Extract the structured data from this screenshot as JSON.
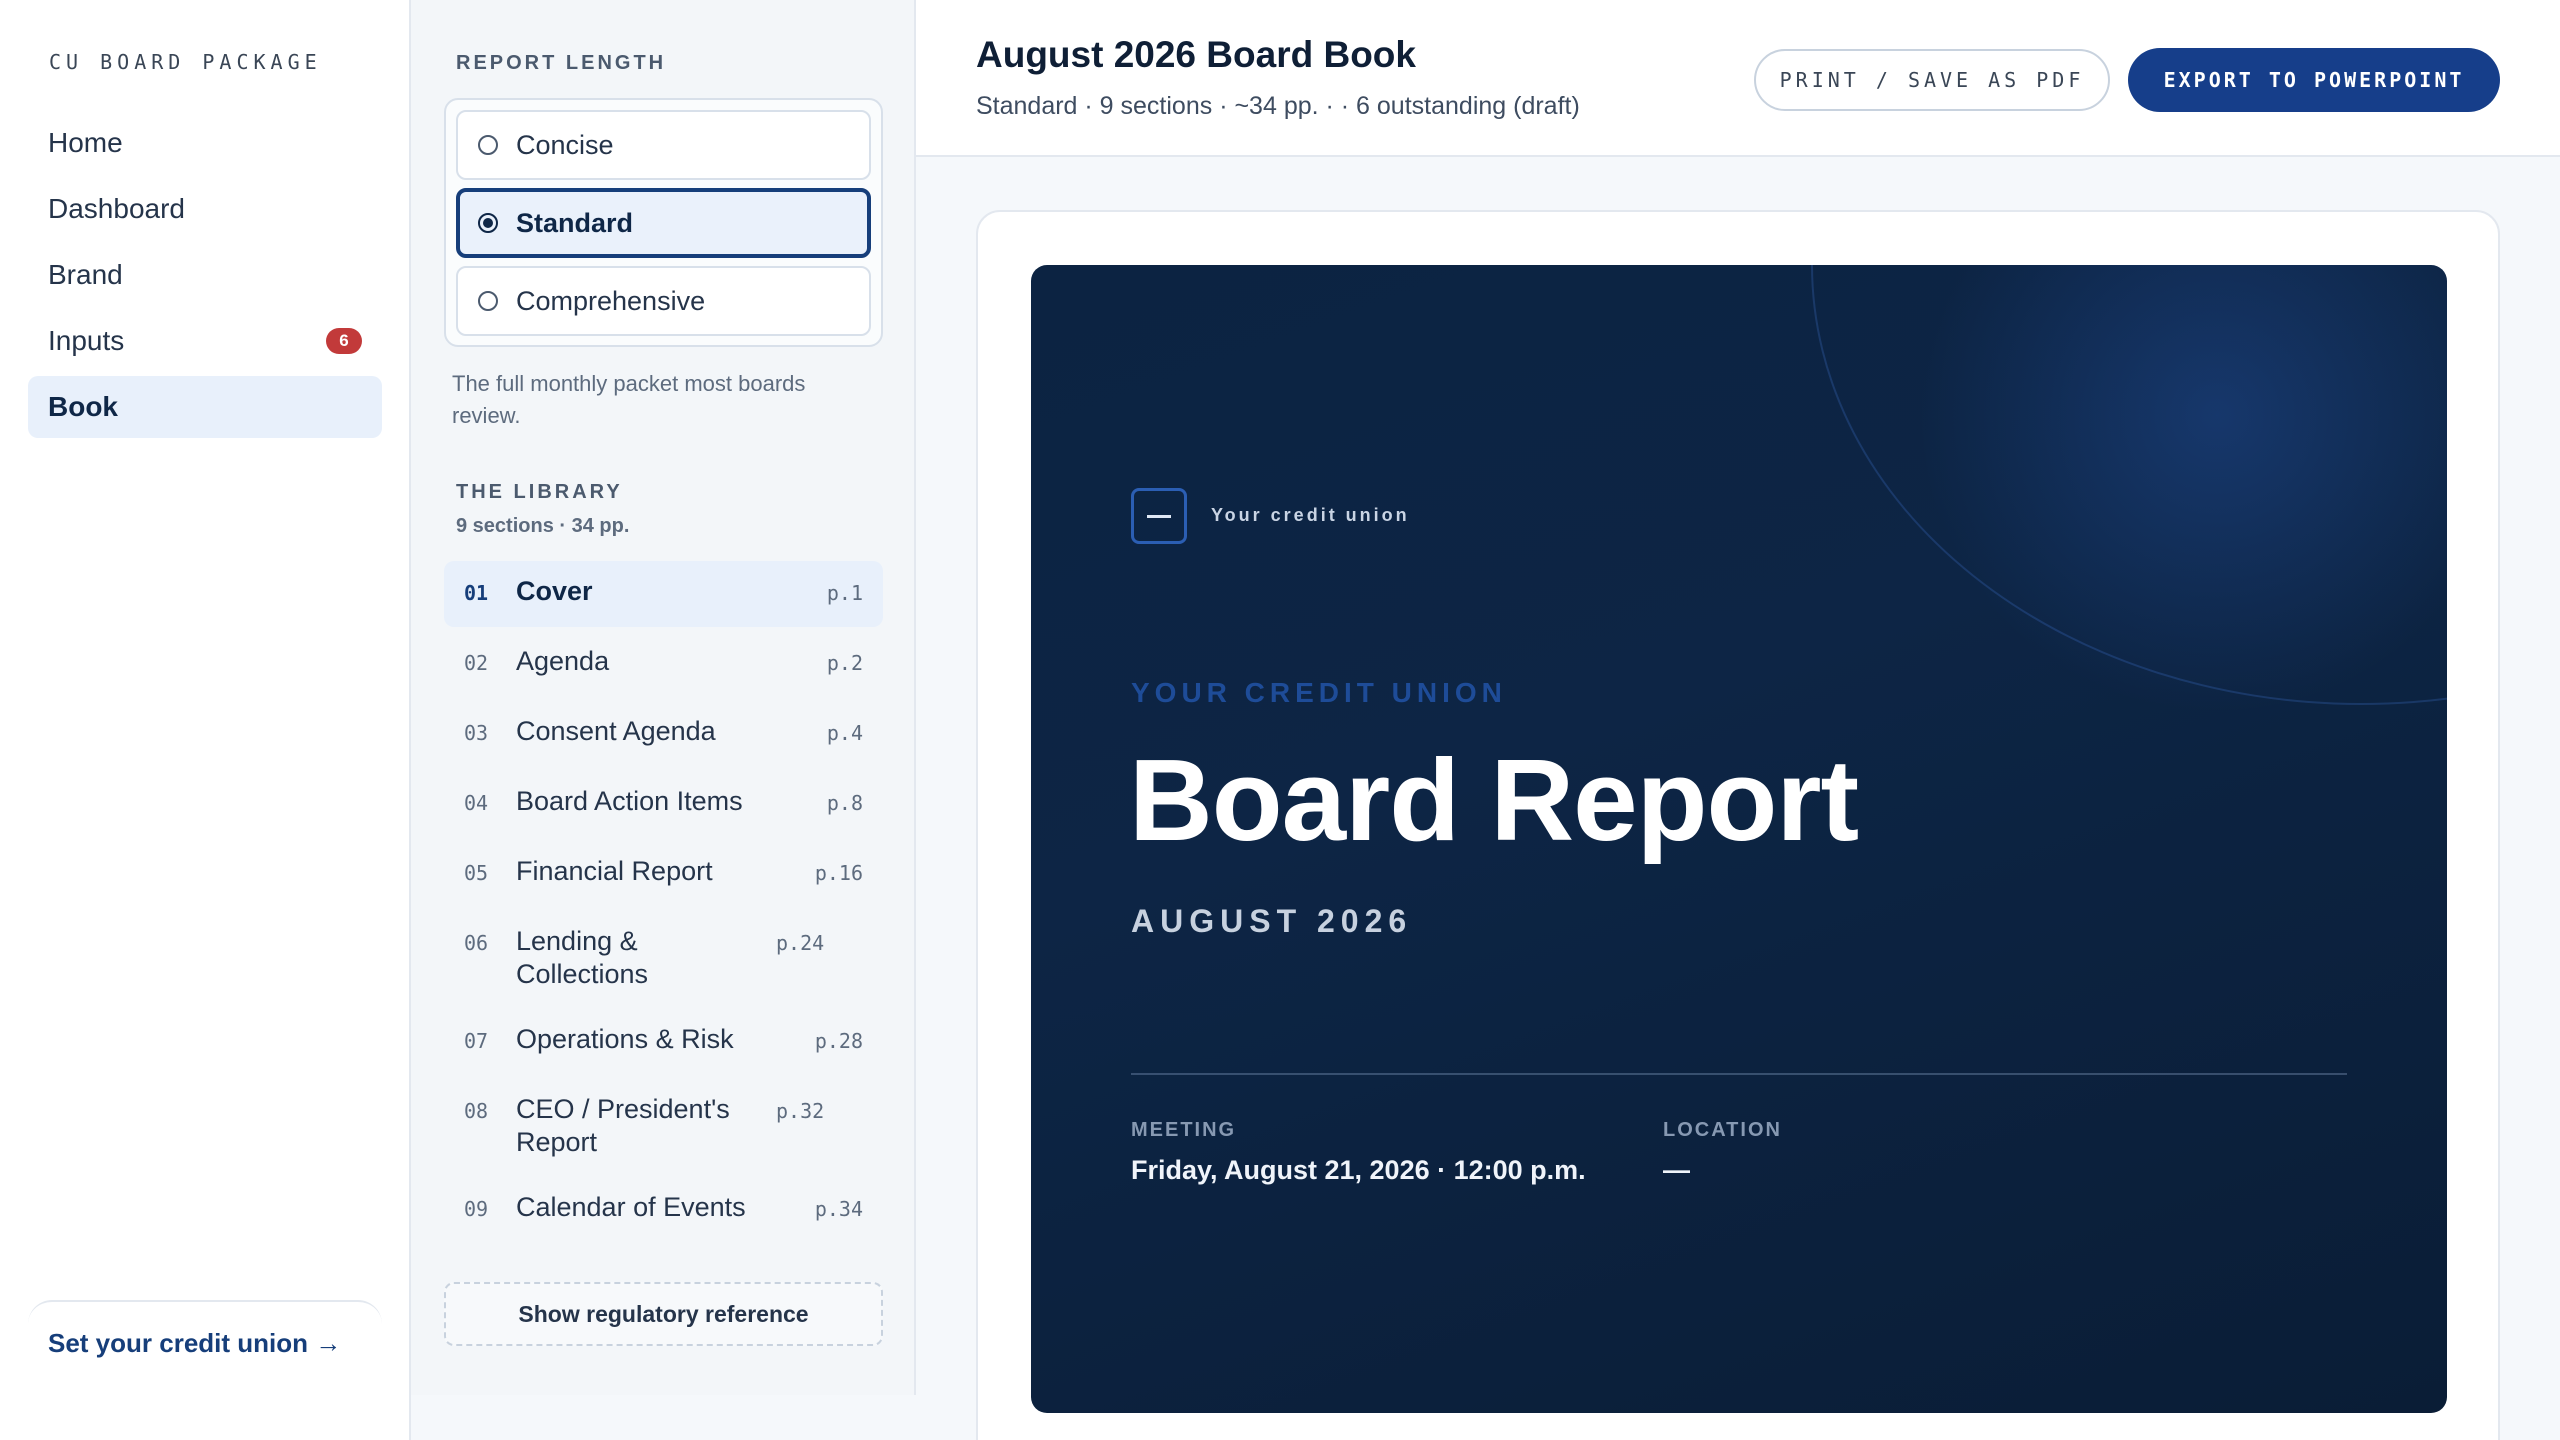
{
  "nav": {
    "brand": "CU BOARD PACKAGE",
    "items": [
      {
        "label": "Home"
      },
      {
        "label": "Dashboard"
      },
      {
        "label": "Brand"
      },
      {
        "label": "Inputs",
        "badge": "6"
      },
      {
        "label": "Book",
        "active": true
      }
    ],
    "footer_link": "Set your credit union →"
  },
  "report_length": {
    "heading": "REPORT LENGTH",
    "options": [
      {
        "label": "Concise",
        "selected": false
      },
      {
        "label": "Standard",
        "selected": true
      },
      {
        "label": "Comprehensive",
        "selected": false
      }
    ],
    "description": "The full monthly packet most boards review."
  },
  "library": {
    "heading": "THE LIBRARY",
    "subtitle": "9 sections · 34 pp.",
    "sections": [
      {
        "num": "01",
        "title": "Cover",
        "page": "p.1",
        "active": true
      },
      {
        "num": "02",
        "title": "Agenda",
        "page": "p.2"
      },
      {
        "num": "03",
        "title": "Consent Agenda",
        "page": "p.4"
      },
      {
        "num": "04",
        "title": "Board Action Items",
        "page": "p.8"
      },
      {
        "num": "05",
        "title": "Financial Report",
        "page": "p.16"
      },
      {
        "num": "06",
        "title": "Lending & Collections",
        "page": "p.24"
      },
      {
        "num": "07",
        "title": "Operations & Risk",
        "page": "p.28"
      },
      {
        "num": "08",
        "title": "CEO / President's Report",
        "page": "p.32"
      },
      {
        "num": "09",
        "title": "Calendar of Events",
        "page": "p.34"
      }
    ],
    "regulatory_button": "Show regulatory reference"
  },
  "header": {
    "title": "August 2026 Board Book",
    "meta": "Standard · 9 sections · ~34 pp. · · 6 outstanding (draft)",
    "print_button": "PRINT / SAVE AS PDF",
    "export_button": "EXPORT TO POWERPOINT"
  },
  "cover": {
    "logo_text": "Your credit union",
    "eyebrow": "YOUR CREDIT UNION",
    "title": "Board Report",
    "date": "AUGUST 2026",
    "meeting_label": "MEETING",
    "meeting_value": "Friday, August 21, 2026 · 12:00 p.m.",
    "location_label": "LOCATION",
    "location_value": "—"
  },
  "colors": {
    "accent": "#163e8a",
    "cover_bg": "#0c2342",
    "badge": "#c23a3a"
  }
}
